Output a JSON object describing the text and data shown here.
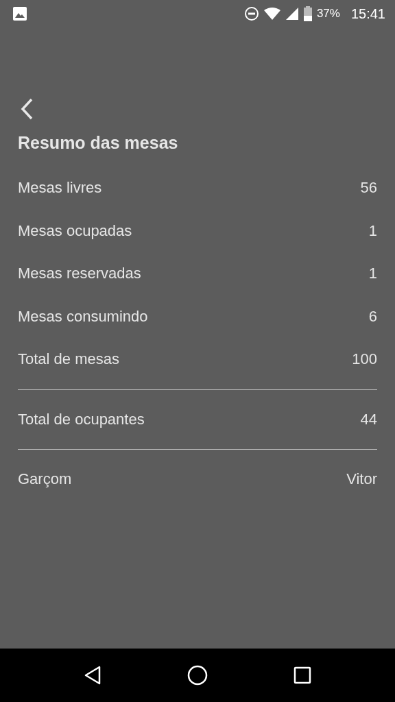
{
  "status_bar": {
    "battery": "37%",
    "time": "15:41"
  },
  "title": "Resumo das mesas",
  "groups": [
    [
      {
        "label": "Mesas livres",
        "value": "56"
      },
      {
        "label": "Mesas ocupadas",
        "value": "1"
      },
      {
        "label": "Mesas reservadas",
        "value": "1"
      },
      {
        "label": "Mesas consumindo",
        "value": "6"
      },
      {
        "label": "Total de mesas",
        "value": "100"
      }
    ],
    [
      {
        "label": "Total de ocupantes",
        "value": "44"
      }
    ],
    [
      {
        "label": "Garçom",
        "value": "Vitor"
      }
    ]
  ]
}
